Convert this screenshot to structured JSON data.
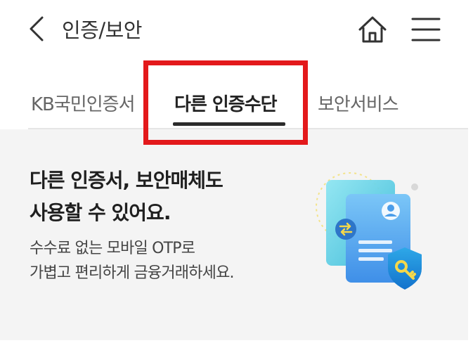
{
  "header": {
    "title": "인증/보안",
    "back_icon": "back-arrow-icon",
    "home_icon": "home-icon",
    "menu_icon": "hamburger-menu-icon"
  },
  "tabs": [
    {
      "label": "KB국민인증서",
      "selected": false
    },
    {
      "label": "다른 인증수단",
      "selected": true
    },
    {
      "label": "보안서비스",
      "selected": false
    }
  ],
  "highlight_color": "#e3191b",
  "banner": {
    "title_line1": "다른 인증서, 보안매체도",
    "title_line2": "사용할 수 있어요.",
    "desc_line1": "수수료 없는 모바일 OTP로",
    "desc_line2": "가볍고 편리하게 금융거래하세요.",
    "illustration_icon": "certificate-shield-key-icon"
  }
}
